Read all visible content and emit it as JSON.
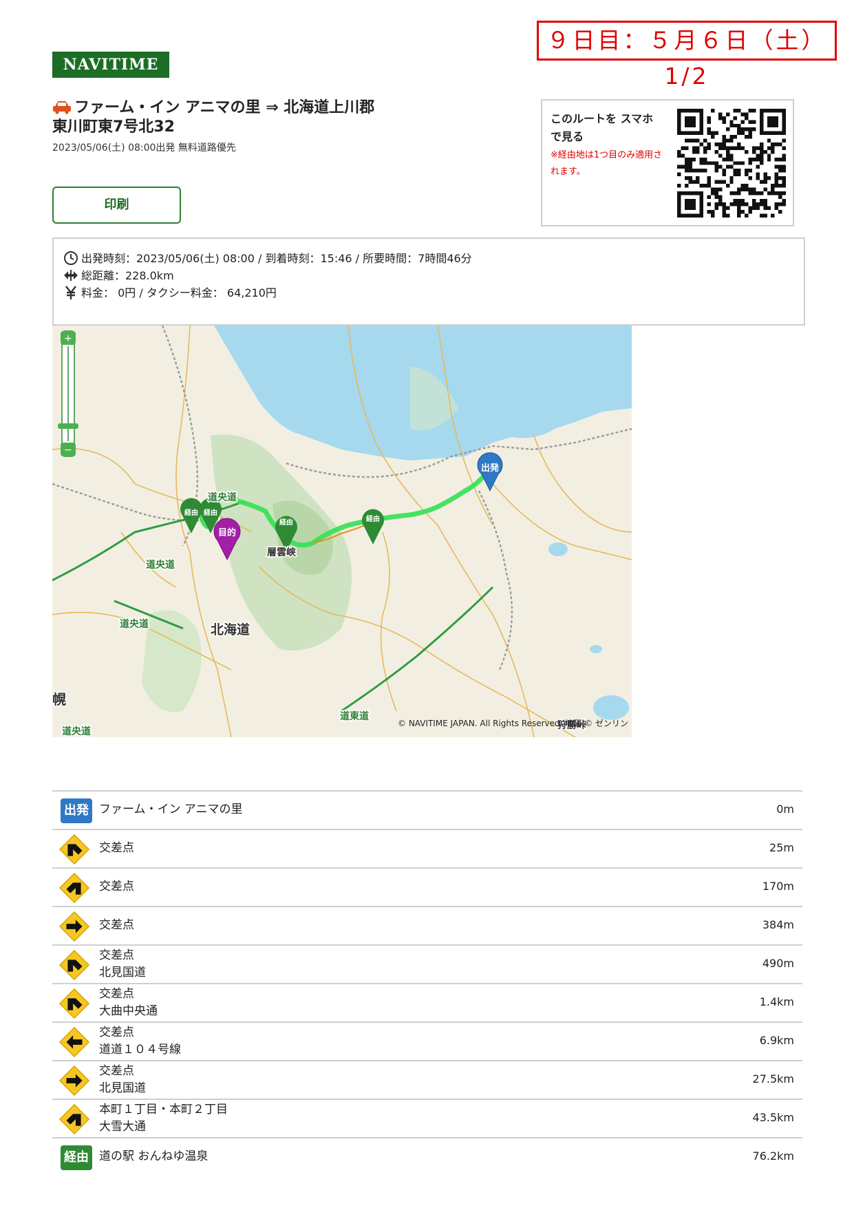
{
  "day_label": "９日目：５月６日（土）1/2",
  "logo": "NAVITIME",
  "route_title": "ファーム・イン アニマの里 ⇒ 北海道上川郡東川町東7号北32",
  "route_subtitle": "2023/05/06(土) 08:00出発 無料道路優先",
  "print_label": "印刷",
  "qr": {
    "title": "このルートを スマホで見る",
    "note": "※経由地は1つ目のみ適用されます。"
  },
  "summary": {
    "times": "出発時刻：2023/05/06(土) 08:00 / 到着時刻：15:46 / 所要時間：7時間46分",
    "distance": "総距離：228.0km",
    "fare": "料金： 0円 / タクシー料金： 64,210円"
  },
  "map": {
    "labels": {
      "hokkaido": "北海道",
      "dooudo_1": "道央道",
      "dooudo_2": "道央道",
      "dooudo_3": "道央道",
      "dooudo_4": "道央道",
      "dotodo": "道東道",
      "sounkyo": "層雲峡",
      "sapporo": "幌",
      "karikachi": "狩勝峠"
    },
    "markers": {
      "start": "出発",
      "goal": "目的",
      "via": "経由"
    },
    "copyright": "© NAVITIME JAPAN. All Rights Reserved. 地図 © ゼンリン"
  },
  "route_steps": [
    {
      "type": "start",
      "badge": "出発",
      "line1": "ファーム・イン アニマの里",
      "line2": "",
      "distance": "0m"
    },
    {
      "type": "turn-left-diag",
      "line1": "交差点",
      "line2": "",
      "distance": "25m"
    },
    {
      "type": "turn-right-diag",
      "line1": "交差点",
      "line2": "",
      "distance": "170m"
    },
    {
      "type": "turn-right",
      "line1": "交差点",
      "line2": "",
      "distance": "384m"
    },
    {
      "type": "turn-left-diag",
      "line1": "交差点",
      "line2": "北見国道",
      "distance": "490m"
    },
    {
      "type": "turn-left-diag",
      "line1": "交差点",
      "line2": "大曲中央通",
      "distance": "1.4km"
    },
    {
      "type": "turn-left",
      "line1": "交差点",
      "line2": "道道１０４号線",
      "distance": "6.9km"
    },
    {
      "type": "turn-right",
      "line1": "交差点",
      "line2": "北見国道",
      "distance": "27.5km"
    },
    {
      "type": "turn-right-diag",
      "line1": "本町１丁目・本町２丁目",
      "line2": "大雪大通",
      "distance": "43.5km"
    },
    {
      "type": "via",
      "badge": "経由",
      "line1": "道の駅 おんねゆ温泉",
      "line2": "",
      "distance": "76.2km"
    }
  ],
  "colors": {
    "brand": "#1c6d25",
    "alert": "#e00000",
    "route": "#3be05a",
    "start_marker": "#2f78c4",
    "goal_marker": "#a21fa6",
    "via_marker": "#2e8b34"
  }
}
